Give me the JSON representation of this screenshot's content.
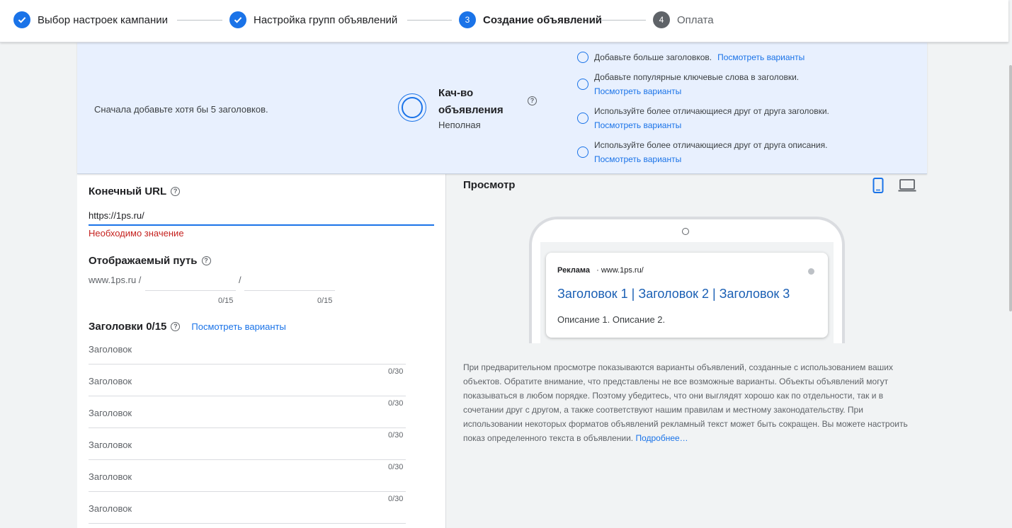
{
  "stepper": {
    "steps": [
      {
        "label": "Выбор настроек кампании",
        "number": "",
        "state": "done"
      },
      {
        "label": "Настройка групп объявлений",
        "number": "",
        "state": "done"
      },
      {
        "label": "Создание объявлений",
        "number": "3",
        "state": "active"
      },
      {
        "label": "Оплата",
        "number": "4",
        "state": "pending"
      }
    ]
  },
  "quality": {
    "hint": "Сначала добавьте хотя бы 5 заголовков.",
    "title": "Кач-во объявления",
    "status": "Неполная",
    "suggestions": [
      {
        "text": "Добавьте больше заголовков.",
        "link": "Посмотреть варианты"
      },
      {
        "text": "Добавьте популярные ключевые слова в заголовки.",
        "link": "Посмотреть варианты"
      },
      {
        "text": "Используйте более отличающиеся друг от друга заголовки.",
        "link": "Посмотреть варианты"
      },
      {
        "text": "Используйте более отличающиеся друг от друга описания.",
        "link": "Посмотреть варианты"
      }
    ]
  },
  "form": {
    "final_url": {
      "label": "Конечный URL",
      "value": "https://1ps.ru/",
      "error": "Необходимо значение"
    },
    "display_path": {
      "label": "Отображаемый путь",
      "prefix": "www.1ps.ru /",
      "separator": "/",
      "counter1": "0/15",
      "counter2": "0/15"
    },
    "headlines": {
      "label": "Заголовки 0/15",
      "link": "Посмотреть варианты",
      "placeholder": "Заголовок",
      "fields": [
        {
          "counter": "0/30"
        },
        {
          "counter": "0/30"
        },
        {
          "counter": "0/30"
        },
        {
          "counter": "0/30"
        },
        {
          "counter": "0/30"
        }
      ]
    }
  },
  "preview": {
    "title": "Просмотр",
    "ad": {
      "badge": "Реклама",
      "url": "· www.1ps.ru/",
      "headline": "Заголовок 1 | Заголовок 2 | Заголовок 3",
      "description": "Описание 1. Описание 2."
    },
    "note": "При предварительном просмотре показываются варианты объявлений, созданные с использованием ваших объектов. Обратите внимание, что представлены не все возможные варианты. Объекты объявлений могут показываться в любом порядке. Поэтому убедитесь, что они выглядят хорошо как по отдельности, так и в сочетании друг с другом, а также соответствуют нашим правилам и местному законодательству. При использовании некоторых форматов объявлений рекламный текст может быть сокращен. Вы можете настроить показ определенного текста в объявлении.",
    "more_link": "Подробнее…"
  },
  "colors": {
    "accent": "#1a73e8",
    "error": "#c5221f",
    "panel": "#e8f0fe"
  }
}
